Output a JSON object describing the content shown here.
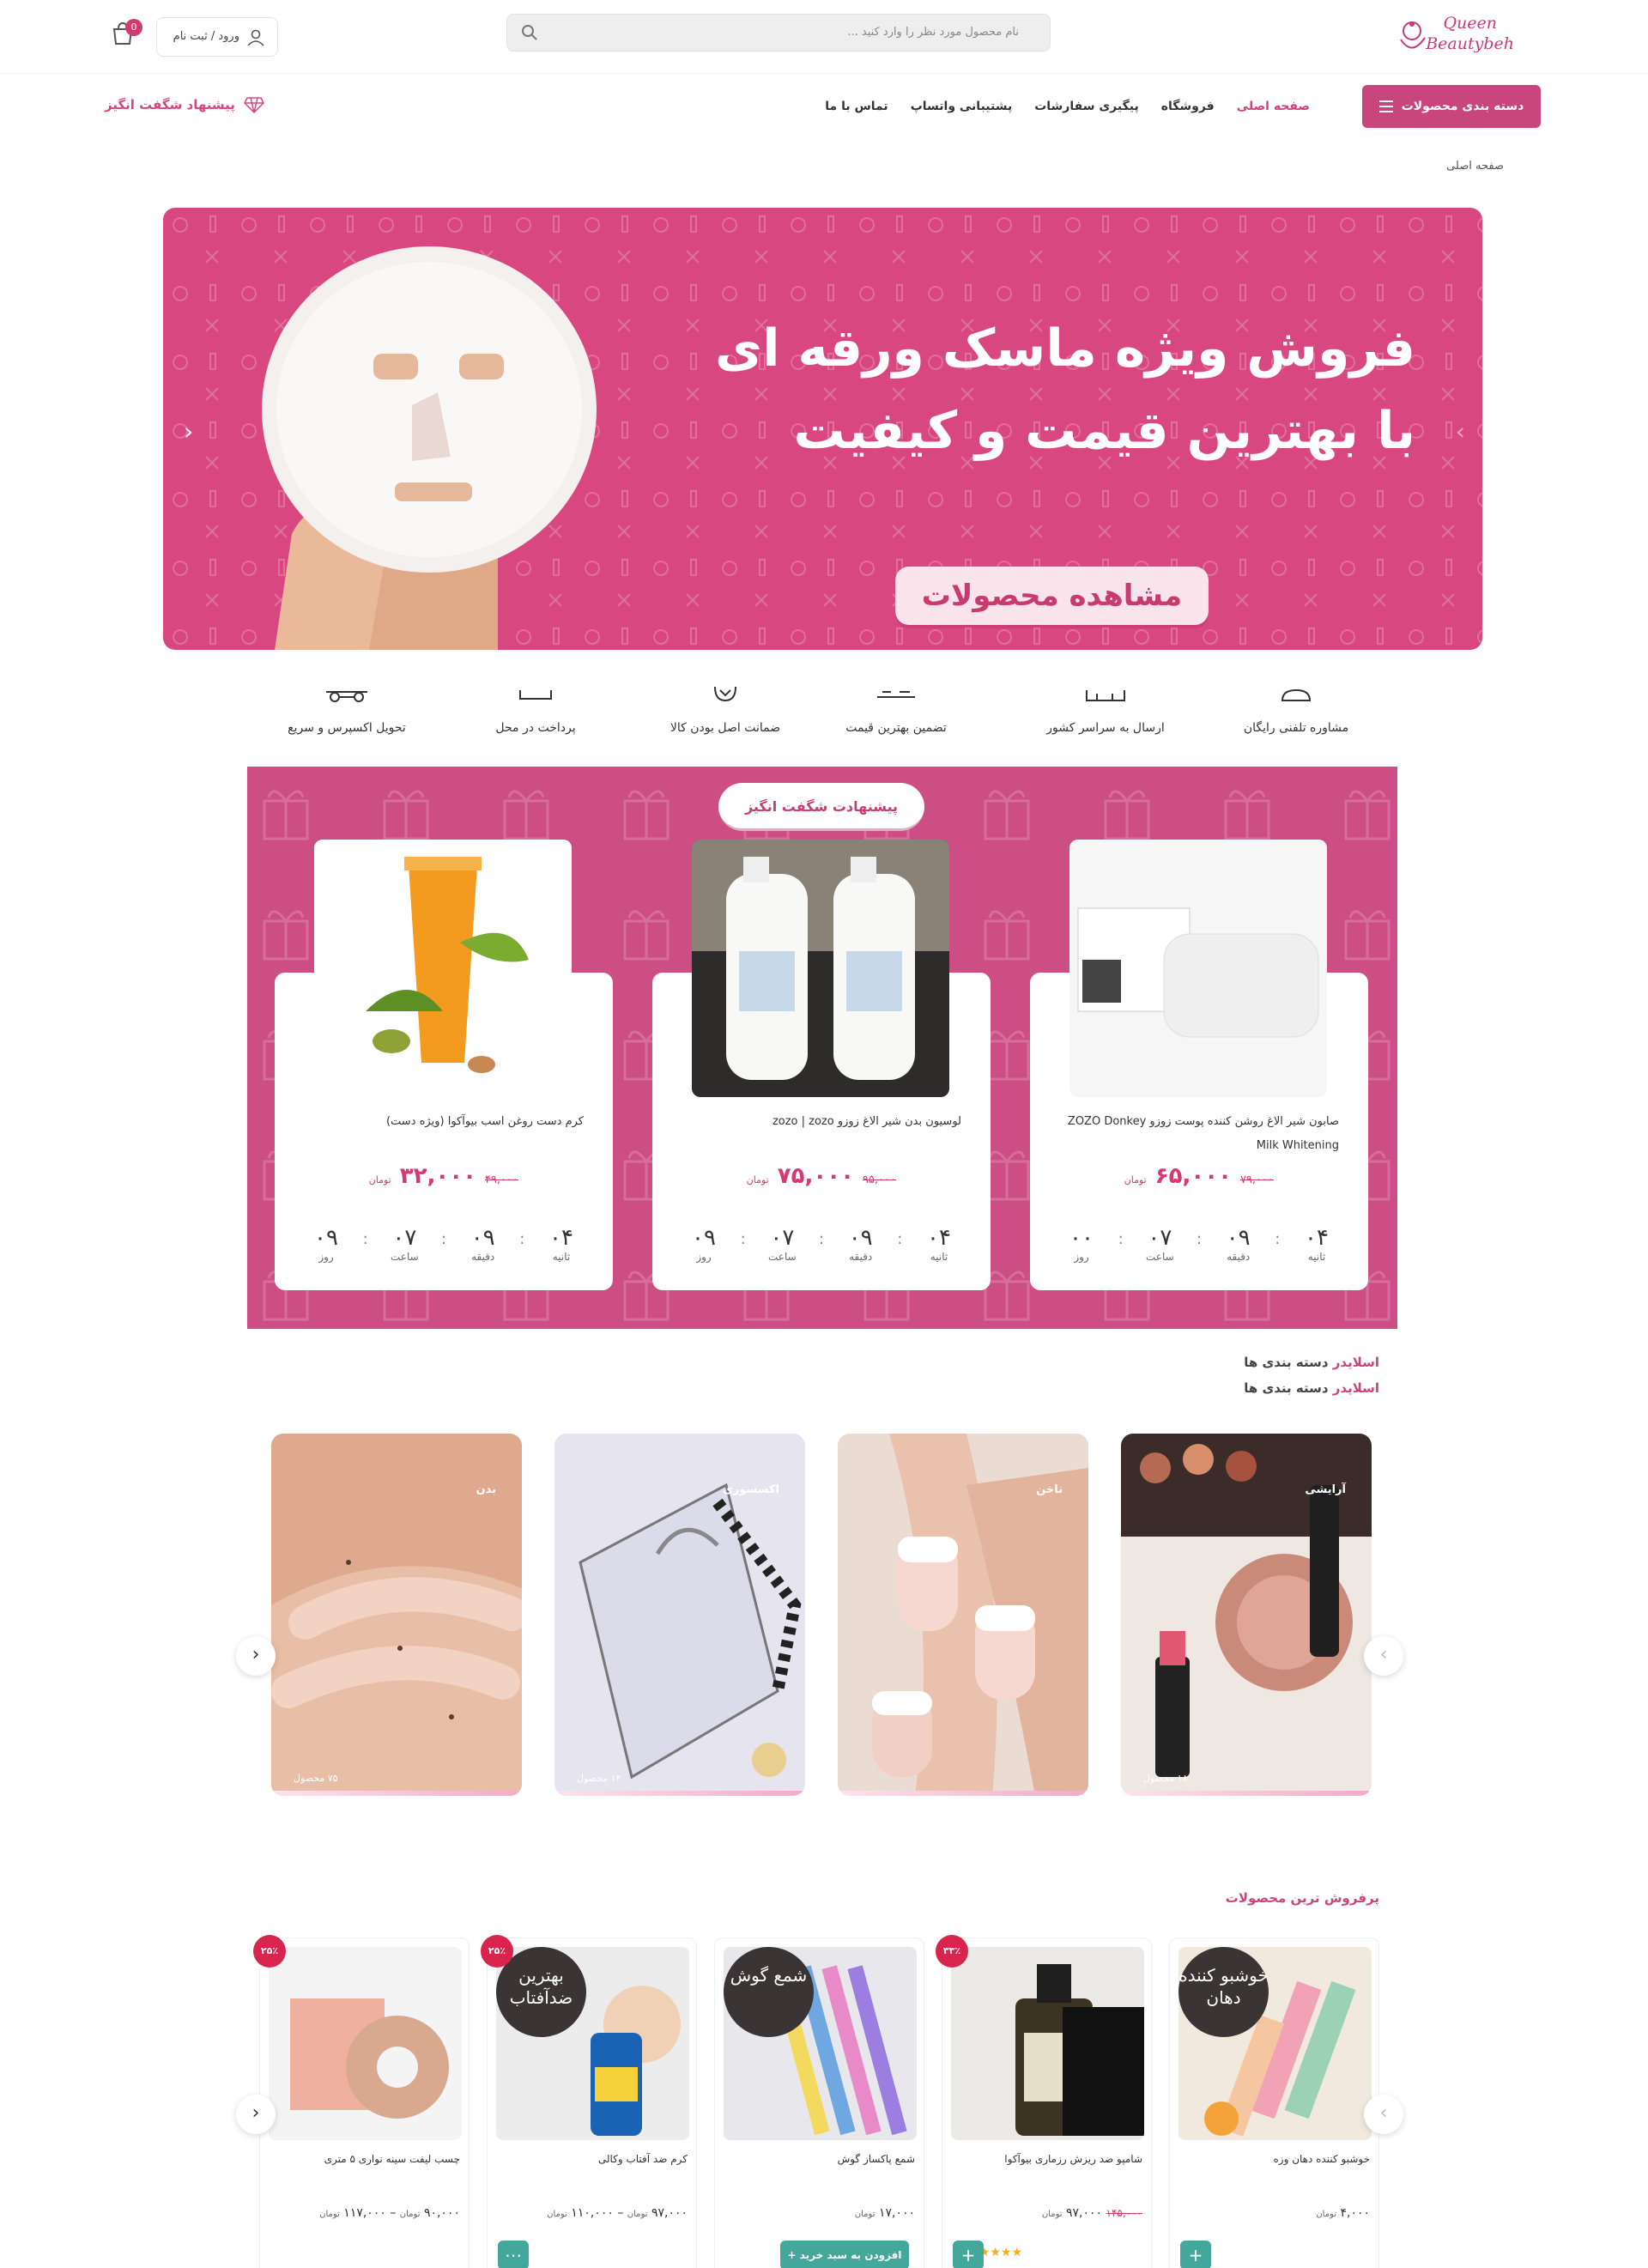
{
  "header": {
    "logo_line1": "Queen",
    "logo_line2": "Beautybeh",
    "search_placeholder": "نام محصول مورد نظر را وارد کنید ...",
    "login_label": "ورود / ثبت نام",
    "cart_count": "0"
  },
  "nav": {
    "categories_button": "دسته بندی محصولات",
    "items": [
      "صفحه اصلی",
      "فروشگاه",
      "پیگیری سفارشات",
      "پشتیبانی واتساپ",
      "تماس با ما"
    ],
    "offer_link": "پیشنهاد شگفت انگیز"
  },
  "breadcrumb": "صفحه اصلی",
  "hero": {
    "line1": "فروش ویژه ماسک ورقه ای",
    "line2": "با بهترین قیمت و کیفیت",
    "cta": "مشاهده محصولات"
  },
  "features": [
    "مشاوره تلفنی رایگان",
    "ارسال به سراسر کشور",
    "تضمین بهترین قیمت",
    "ضمانت اصل بودن کالا",
    "پرداخت در محل",
    "تحویل اکسپرس و سریع"
  ],
  "amazing": {
    "title": "پیشنهادت شگفت انگیز",
    "currency": "تومان",
    "timer_labels": {
      "sec": "ثانیه",
      "min": "دقیقه",
      "hour": "ساعت",
      "day": "روز"
    },
    "products": [
      {
        "name": "صابون شیر الاغ روشن کننده پوست زوزو ZOZO Donkey Milk Whitening",
        "old": "۷۹,۰۰۰",
        "new": "۶۵,۰۰۰",
        "sec": "۰۴",
        "min": "۰۹",
        "hour": "۰۷",
        "day": "۰۰"
      },
      {
        "name": "لوسیون بدن شیر الاغ زوزو zozo | zozo",
        "old": "۹۵,۰۰۰",
        "new": "۷۵,۰۰۰",
        "sec": "۰۴",
        "min": "۰۹",
        "hour": "۰۷",
        "day": "۰۹"
      },
      {
        "name": "کرم دست روغن اسب بیوآکوا (ویژه دست)",
        "old": "۴۹,۰۰۰",
        "new": "۳۲,۰۰۰",
        "sec": "۰۴",
        "min": "۰۹",
        "hour": "۰۷",
        "day": "۰۹"
      }
    ]
  },
  "category_slider": {
    "title_strong": "اسلایدر",
    "title_rest": "دسته بندی ها",
    "cards": [
      {
        "name": "آرایشی",
        "count": "۱۸ محصول"
      },
      {
        "name": "ناخن",
        "count": ""
      },
      {
        "name": "اکسسوری",
        "count": "۱۴ محصول"
      },
      {
        "name": "بدن",
        "count": "۷۵ محصول"
      }
    ]
  },
  "bestsellers": {
    "title": "پرفروش ترین محصولات",
    "currency": "تومان",
    "add_to_cart": "افزودن به سبد خرید",
    "products": [
      {
        "name": "خوشبو کننده دهان وزه",
        "price": "۴,۰۰۰",
        "badge_text": "خوشبو کننده دهان",
        "discount": ""
      },
      {
        "name": "شامپو ضد ریزش رزماری بیوآکوا",
        "price": "۹۷,۰۰۰",
        "old": "۱۴۵,۰۰۰",
        "badge_text": "",
        "discount": "۳۳٪"
      },
      {
        "name": "شمع پاکساز گوش",
        "price": "۱۷,۰۰۰",
        "badge_text": "شمع گوش",
        "discount": ""
      },
      {
        "name": "کرم ضد آفتاب وکالی",
        "price": "۹۷,۰۰۰",
        "price_max": "۱۱۰,۰۰۰",
        "badge_text": "بهترین ضدآفتاب",
        "discount": "۲۵٪"
      },
      {
        "name": "چسب لیفت سینه نواری ۵ متری",
        "price": "۹۰,۰۰۰",
        "price_max": "۱۱۷,۰۰۰",
        "badge_text": "",
        "discount": "۲۵٪"
      }
    ]
  },
  "colors": {
    "brand": "#c8457e",
    "accent_green": "#43a89b",
    "discount_red": "#d9244d"
  }
}
